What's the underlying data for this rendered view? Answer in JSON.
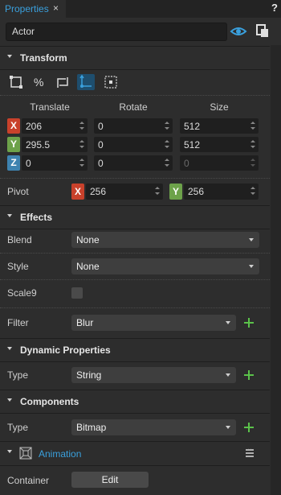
{
  "tab": {
    "label": "Properties",
    "close": "×"
  },
  "help": "?",
  "name_field": {
    "value": "Actor"
  },
  "sections": {
    "transform": "Transform",
    "effects": "Effects",
    "dynamic": "Dynamic Properties",
    "components": "Components",
    "animation": "Animation"
  },
  "transform": {
    "columns": [
      "Translate",
      "Rotate",
      "Size"
    ],
    "axes": [
      "X",
      "Y",
      "Z"
    ],
    "translate": [
      "206",
      "295.5",
      "0"
    ],
    "rotate": [
      "0",
      "0",
      "0"
    ],
    "size": [
      "512",
      "512",
      "0"
    ],
    "pivot_label": "Pivot",
    "pivot_x": "256",
    "pivot_y": "256"
  },
  "effects": {
    "blend_label": "Blend",
    "blend_value": "None",
    "style_label": "Style",
    "style_value": "None",
    "scale9_label": "Scale9",
    "filter_label": "Filter",
    "filter_value": "Blur"
  },
  "dynamic": {
    "type_label": "Type",
    "type_value": "String"
  },
  "components": {
    "type_label": "Type",
    "type_value": "Bitmap"
  },
  "animation": {
    "container_label": "Container",
    "edit_label": "Edit"
  },
  "colors": {
    "accent": "#3aa0dd",
    "x": "#c9412b",
    "y": "#6da24a",
    "z": "#3e83b0",
    "add": "#5bc24a"
  },
  "icons": [
    "eye-icon",
    "copy-icon",
    "bounding-box-icon",
    "percent-icon",
    "resize-icon",
    "pivot-icon",
    "anchor-icon",
    "plus-icon",
    "film-icon",
    "menu-icon"
  ]
}
